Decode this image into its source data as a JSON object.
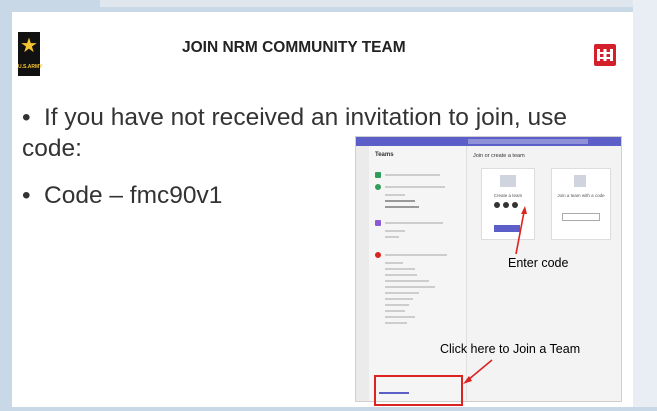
{
  "slide": {
    "title": "JOIN NRM COMMUNITY TEAM",
    "logo_left_text": "U.S.ARMY",
    "bullets": [
      {
        "marker": "•",
        "text": "If you have not received an invitation to join, use code:"
      },
      {
        "marker": "•",
        "text": "Code – fmc90v1"
      }
    ]
  },
  "screenshot": {
    "teams_title": "Teams",
    "main_title": "Join or create a team",
    "create_label": "Create a team",
    "join_label": "Join a team with a code"
  },
  "annotations": {
    "enter_code": "Enter code",
    "join_team": "Click here to Join a Team"
  },
  "colors": {
    "red": "#d22222",
    "teams_purple": "#5b5fc7",
    "frame": "#c9d8e6"
  },
  "icons": [
    "army-star-icon",
    "usace-castle-icon"
  ]
}
